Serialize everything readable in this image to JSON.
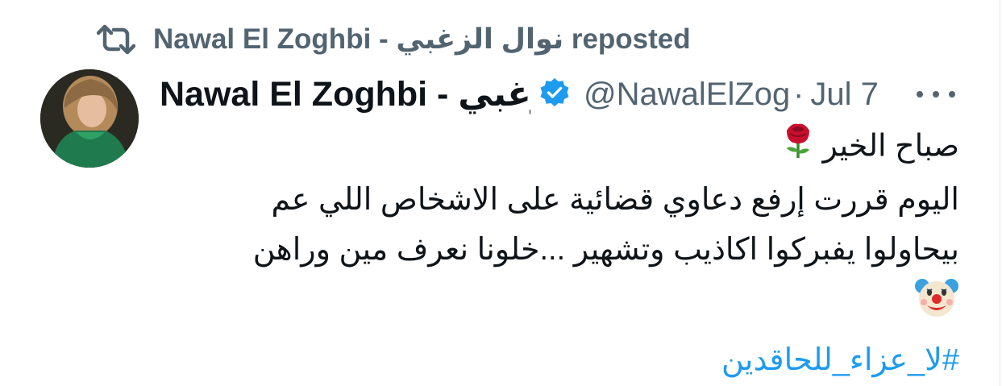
{
  "repost": {
    "icon": "repost-icon",
    "text": "Nawal El Zoghbi - نوال الزغبي reposted"
  },
  "author": {
    "name": "Nawal El Zoghbi - نوال الزغبي",
    "verified_icon": "verified-badge-icon",
    "handle": "@NawalElZoghbi",
    "separator": "·",
    "date": "Jul 7",
    "more_icon": "more-options-icon"
  },
  "tweet": {
    "line1": "صباح الخير",
    "line1_emoji": "rose-emoji",
    "line2": "اليوم قررت إرفع دعاوي قضائية على الاشخاص اللي عم",
    "line3": "بيحاولوا يفبركوا اكاذيب وتشهير ...خلونا نعرف مين وراهن",
    "line4_emoji": "clown-face-emoji",
    "hashtag": "#لا_عزاء_للحاقدين"
  },
  "colors": {
    "text": "#0f1419",
    "secondary": "#536471",
    "link": "#1d9bf0",
    "verified": "#1d9bf0"
  }
}
